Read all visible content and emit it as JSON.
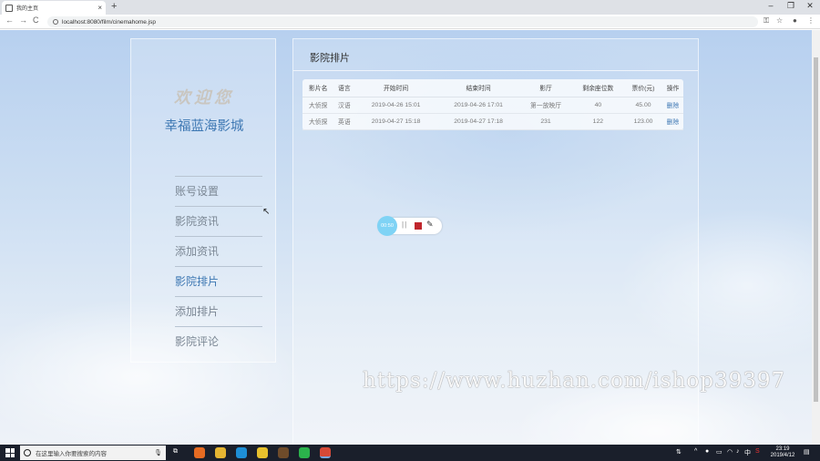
{
  "browser": {
    "tab_title": "我的主页",
    "tab_close": "×",
    "new_tab": "+",
    "url": "localhost:8080/film/cinemahome.jsp",
    "win_min": "–",
    "win_max": "❐",
    "win_close": "✕",
    "back": "←",
    "forward": "→",
    "reload": "C",
    "key_icon": "⚿",
    "star": "☆",
    "account": "●",
    "menu": "⋮"
  },
  "sidebar": {
    "welcome": "欢迎您",
    "cinema_name": "幸福蓝海影城",
    "items": [
      {
        "label": "账号设置",
        "active": false
      },
      {
        "label": "影院资讯",
        "active": false
      },
      {
        "label": "添加资讯",
        "active": false
      },
      {
        "label": "影院排片",
        "active": true
      },
      {
        "label": "添加排片",
        "active": false
      },
      {
        "label": "影院评论",
        "active": false
      }
    ]
  },
  "main": {
    "title": "影院排片",
    "table": {
      "headers": [
        "影片名",
        "语言",
        "开始时间",
        "结束时间",
        "影厅",
        "剩余座位数",
        "票价(元)",
        "操作"
      ],
      "rows": [
        [
          "大侦探",
          "汉语",
          "2019-04-26 15:01",
          "2019-04-26 17:01",
          "第一放映厅",
          "40",
          "45.00",
          "删除"
        ],
        [
          "大侦探",
          "英语",
          "2019-04-27 15:18",
          "2019-04-27 17:18",
          "231",
          "122",
          "123.00",
          "删除"
        ]
      ]
    }
  },
  "recorder": {
    "timer": "00:50",
    "pause": "||"
  },
  "watermark": "https://www.huzhan.com/ishop39397",
  "taskbar": {
    "search_placeholder": "在这里输入你要搜索的内容",
    "time": "23:19",
    "date": "2019/4/12",
    "ime": "中"
  }
}
